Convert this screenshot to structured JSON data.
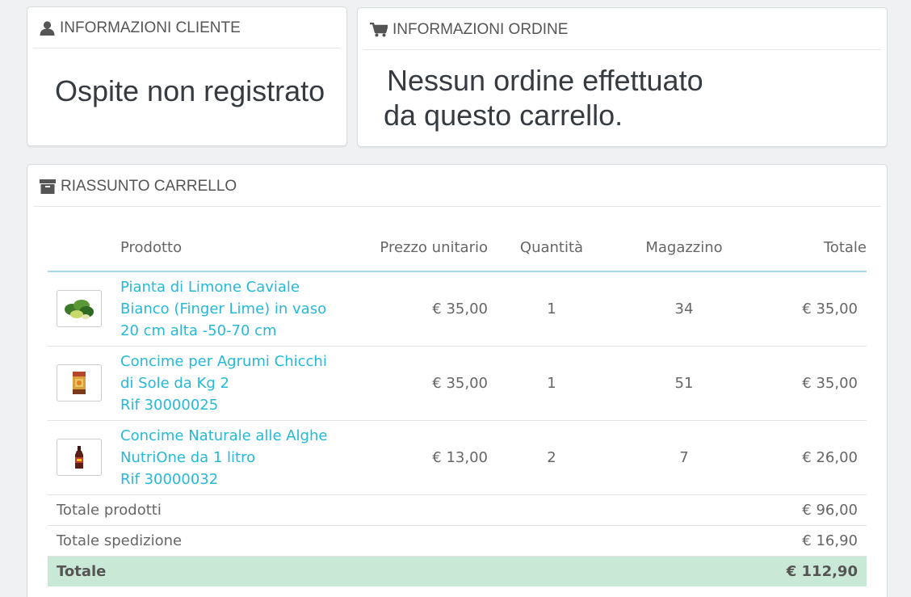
{
  "customer_panel": {
    "title": "INFORMAZIONI CLIENTE",
    "icon": "user-icon",
    "message": "Ospite non registrato"
  },
  "order_panel": {
    "title": "INFORMAZIONI ORDINE",
    "icon": "shopping-cart-icon",
    "message_line1": "Nessun ordine effettuato",
    "message_line2": "da questo carrello."
  },
  "cart_panel": {
    "title": "RIASSUNTO CARRELLO",
    "icon": "archive-box-icon",
    "columns": {
      "product": "Prodotto",
      "unit_price": "Prezzo unitario",
      "quantity": "Quantità",
      "stock": "Magazzino",
      "total": "Totale"
    },
    "products": [
      {
        "name_lines": [
          "Pianta di Limone Caviale",
          "Bianco (Finger Lime) in vaso",
          "20 cm alta -50-70 cm"
        ],
        "thumbnail": "finger-lime-plant-thumbnail",
        "unit_price": "€ 35,00",
        "quantity": "1",
        "stock": "34",
        "total": "€ 35,00"
      },
      {
        "name_lines": [
          "Concime per Agrumi Chicchi",
          "di Sole da Kg 2",
          "Rif 30000025"
        ],
        "thumbnail": "citrus-fertilizer-box-thumbnail",
        "unit_price": "€ 35,00",
        "quantity": "1",
        "stock": "51",
        "total": "€ 35,00"
      },
      {
        "name_lines": [
          "Concime Naturale alle Alghe",
          "NutriOne da 1 litro",
          "Rif 30000032"
        ],
        "thumbnail": "seaweed-fertilizer-bottle-thumbnail",
        "unit_price": "€ 13,00",
        "quantity": "2",
        "stock": "7",
        "total": "€ 26,00"
      }
    ],
    "summary": {
      "products_total_label": "Totale prodotti",
      "products_total_value": "€ 96,00",
      "shipping_total_label": "Totale spedizione",
      "shipping_total_value": "€ 16,90",
      "grand_total_label": "Totale",
      "grand_total_value": "€ 112,90"
    }
  },
  "colors": {
    "link": "#25b9d7",
    "total_row_bg": "#c9e9d6",
    "header_underline": "#a7d8ee"
  }
}
